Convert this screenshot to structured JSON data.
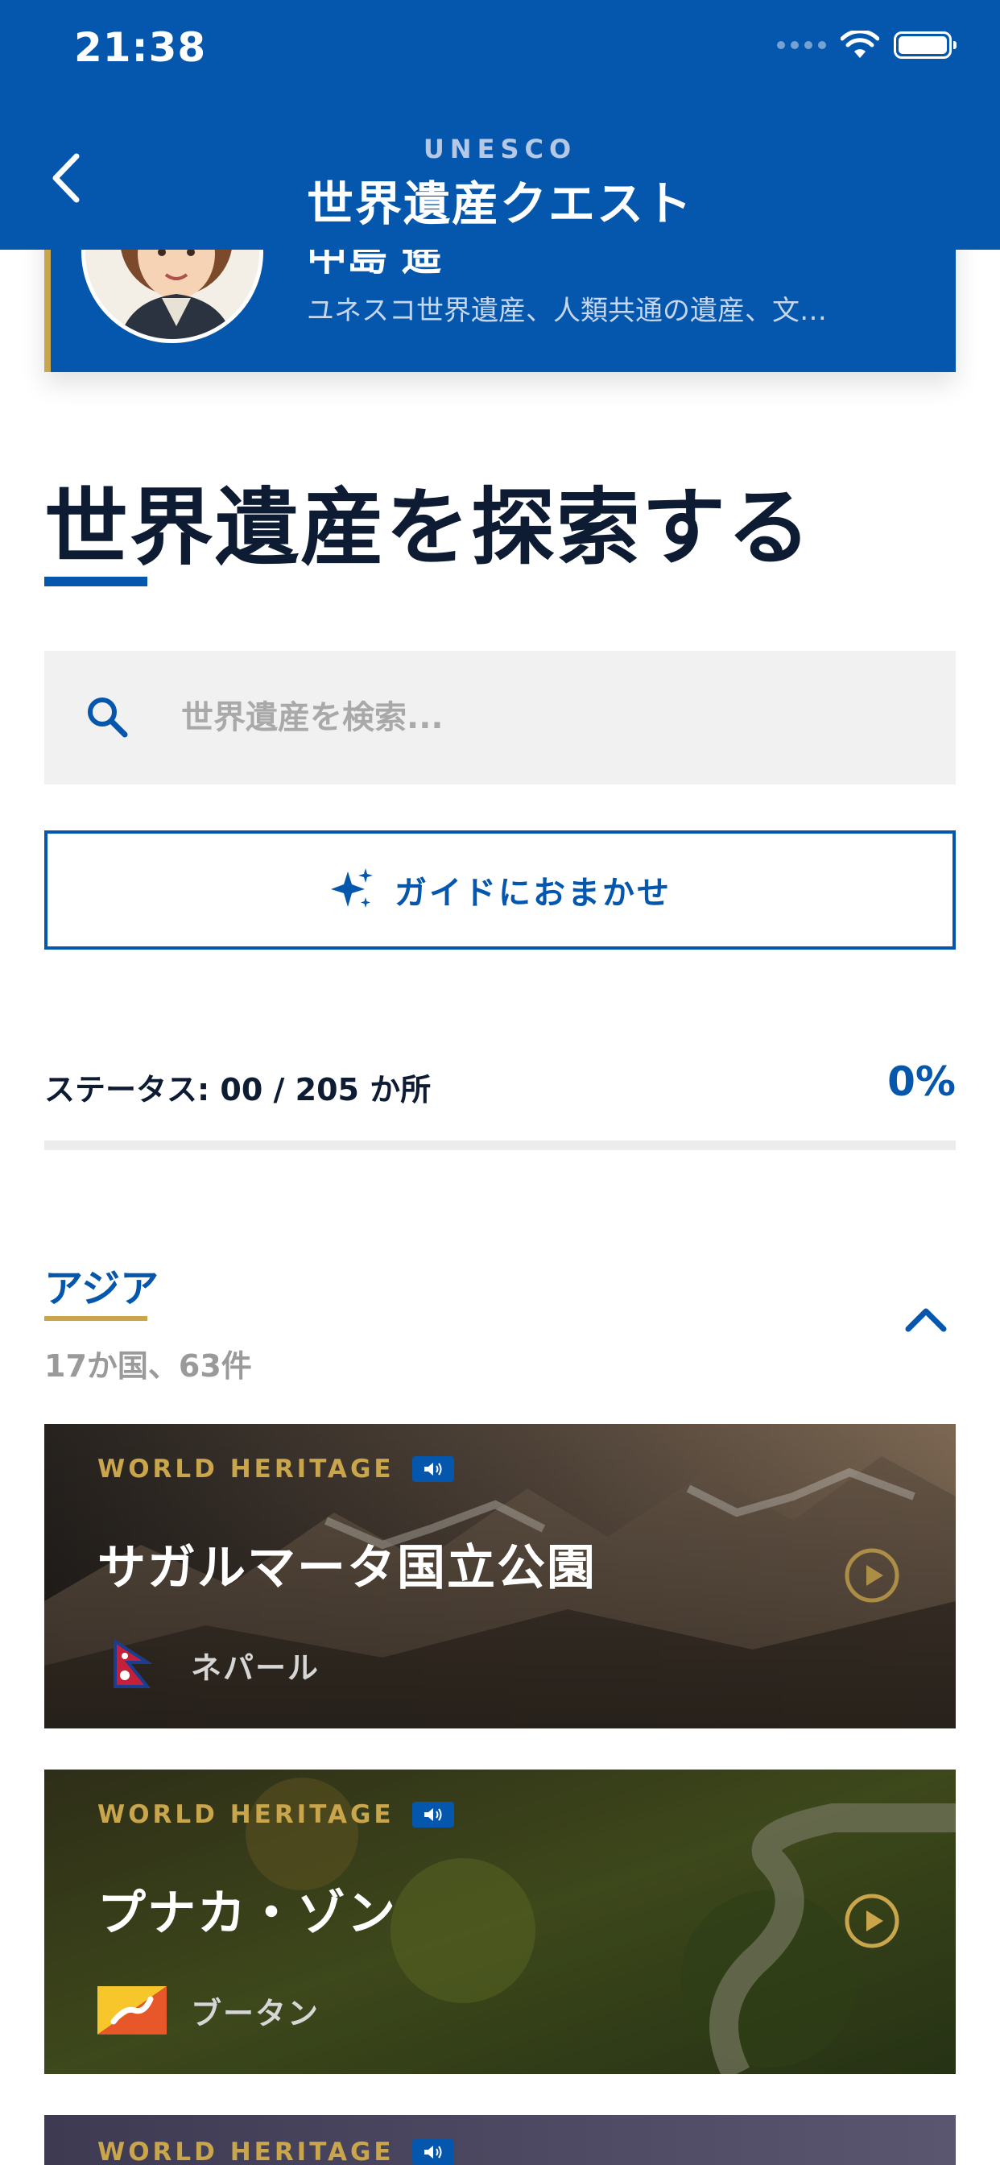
{
  "status_bar": {
    "time": "21:38"
  },
  "header": {
    "subtitle": "UNESCO",
    "title": "世界遺産クエスト"
  },
  "profile": {
    "name": "中島 遥",
    "description": "ユネスコ世界遺産、人類共通の遺産、文…"
  },
  "page": {
    "title": "世界遺産を探索する"
  },
  "search": {
    "placeholder": "世界遺産を検索..."
  },
  "guide_button": {
    "label": "ガイドにおまかせ"
  },
  "status": {
    "label": "ステータス: 00 / 205 か所",
    "percent": "0%",
    "progress": 0
  },
  "region": {
    "name": "アジア",
    "count": "17か国、63件",
    "sites": [
      {
        "tag": "WORLD HERITAGE",
        "name": "サガルマータ国立公園",
        "country": "ネパール",
        "flag_icon": "nepal-flag-icon"
      },
      {
        "tag": "WORLD HERITAGE",
        "name": "プナカ・ゾン",
        "country": "ブータン",
        "flag_icon": "bhutan-flag-icon"
      },
      {
        "tag": "WORLD HERITAGE"
      }
    ]
  },
  "colors": {
    "primary": "#0457ad",
    "accent_gold": "#c9a54b",
    "text_dark": "#0d1b33"
  }
}
